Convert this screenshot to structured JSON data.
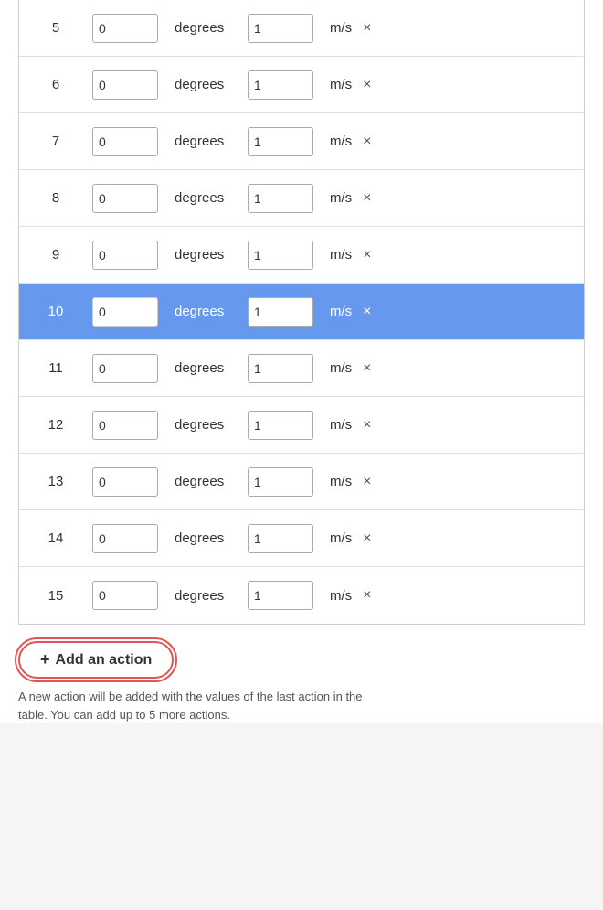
{
  "table": {
    "rows": [
      {
        "id": 5,
        "angle": "0",
        "unit1": "degrees",
        "speed": "1",
        "unit2": "m/s",
        "highlighted": false
      },
      {
        "id": 6,
        "angle": "0",
        "unit1": "degrees",
        "speed": "1",
        "unit2": "m/s",
        "highlighted": false
      },
      {
        "id": 7,
        "angle": "0",
        "unit1": "degrees",
        "speed": "1",
        "unit2": "m/s",
        "highlighted": false
      },
      {
        "id": 8,
        "angle": "0",
        "unit1": "degrees",
        "speed": "1",
        "unit2": "m/s",
        "highlighted": false
      },
      {
        "id": 9,
        "angle": "0",
        "unit1": "degrees",
        "speed": "1",
        "unit2": "m/s",
        "highlighted": false
      },
      {
        "id": 10,
        "angle": "0",
        "unit1": "degrees",
        "speed": "1",
        "unit2": "m/s",
        "highlighted": true
      },
      {
        "id": 11,
        "angle": "0",
        "unit1": "degrees",
        "speed": "1",
        "unit2": "m/s",
        "highlighted": false
      },
      {
        "id": 12,
        "angle": "0",
        "unit1": "degrees",
        "speed": "1",
        "unit2": "m/s",
        "highlighted": false
      },
      {
        "id": 13,
        "angle": "0",
        "unit1": "degrees",
        "speed": "1",
        "unit2": "m/s",
        "highlighted": false
      },
      {
        "id": 14,
        "angle": "0",
        "unit1": "degrees",
        "speed": "1",
        "unit2": "m/s",
        "highlighted": false
      },
      {
        "id": 15,
        "angle": "0",
        "unit1": "degrees",
        "speed": "1",
        "unit2": "m/s",
        "highlighted": false
      }
    ],
    "delete_icon": "×"
  },
  "add_action": {
    "button_label": "Add an action",
    "plus": "+",
    "hint": "A new action will be added with the values of the last action in the table. You can add up to 5 more actions."
  }
}
